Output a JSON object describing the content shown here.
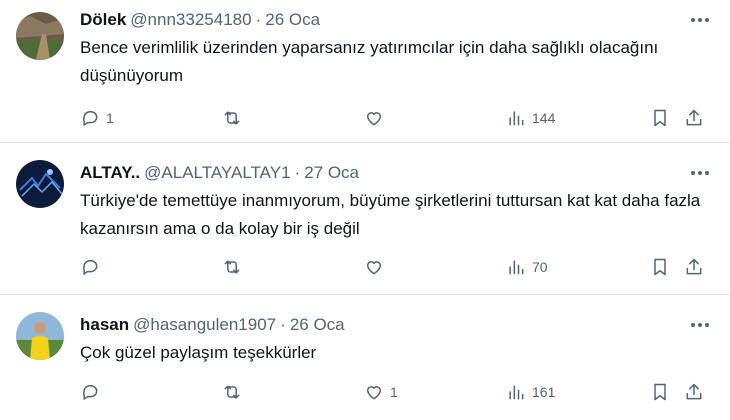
{
  "tweets": [
    {
      "name": "Dölek",
      "handle": "@nnn33254180",
      "separator": "·",
      "date": "26 Oca",
      "text": "Bence verimlilik üzerinden yaparsanız yatırımcılar için daha sağlıklı olacağını düşünüyorum",
      "replies": "1",
      "retweets": "",
      "likes": "",
      "views": "144"
    },
    {
      "name": "ALTAY..",
      "handle": "@ALALTAYALTAY1",
      "separator": "·",
      "date": "27 Oca",
      "text": "Türkiye'de temettüye inanmıyorum, büyüme şirketlerini tuttursan kat kat daha fazla kazanırsın ama o da kolay bir iş değil",
      "replies": "",
      "retweets": "",
      "likes": "",
      "views": "70"
    },
    {
      "name": "hasan",
      "handle": "@hasangulen1907",
      "separator": "·",
      "date": "26 Oca",
      "text": "Çok güzel paylaşım teşekkürler",
      "replies": "",
      "retweets": "",
      "likes": "1",
      "views": "161"
    }
  ],
  "icons": {
    "reply": "reply-icon",
    "retweet": "retweet-icon",
    "like": "heart-icon",
    "views": "views-icon",
    "bookmark": "bookmark-icon",
    "share": "share-icon",
    "more": "more-icon"
  },
  "colors": {
    "text": "#0f1419",
    "secondary": "#536471",
    "border": "#e6e9ec"
  }
}
